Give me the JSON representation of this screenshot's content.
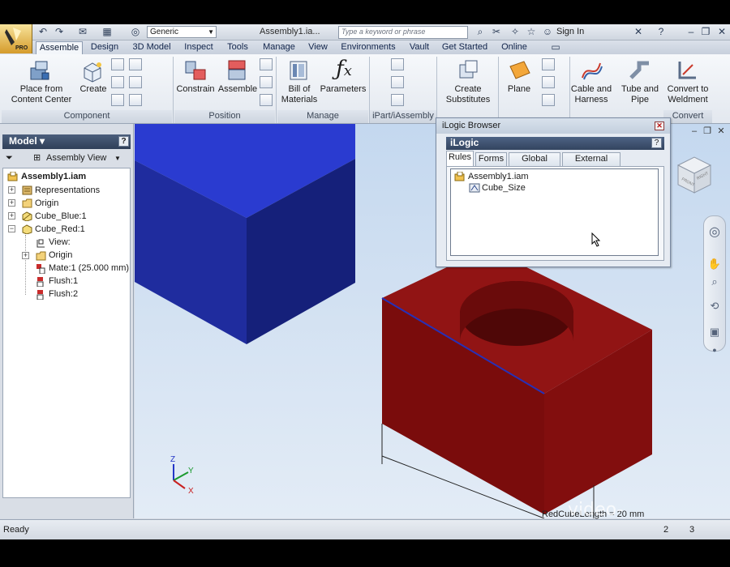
{
  "quick_access": {
    "style_value": "Generic",
    "document_title": "Assembly1.ia...",
    "search_placeholder": "Type a keyword or phrase",
    "sign_in": "Sign In",
    "app_badge": "PRO"
  },
  "tabs": [
    "Assemble",
    "Design",
    "3D Model",
    "Inspect",
    "Tools",
    "Manage",
    "View",
    "Environments",
    "Vault",
    "Get Started",
    "Online"
  ],
  "active_tab": "Assemble",
  "ribbon": {
    "place_line1": "Place from",
    "place_line2": "Content Center",
    "create": "Create",
    "constrain": "Constrain",
    "assemble": "Assemble",
    "bom_line1": "Bill of",
    "bom_line2": "Materials",
    "parameters": "Parameters",
    "substitutes_line1": "Create",
    "substitutes_line2": "Substitutes",
    "plane": "Plane",
    "cable_line1": "Cable and",
    "cable_line2": "Harness",
    "tube_line1": "Tube and",
    "tube_line2": "Pipe",
    "weldment_line1": "Convert to",
    "weldment_line2": "Weldment",
    "groups": {
      "component": "Component",
      "position": "Position",
      "manage": "Manage",
      "ipart": "iPart/iAssembly",
      "convert": "Convert"
    }
  },
  "browser": {
    "title": "Model",
    "view_combo": "Assembly View",
    "nodes": {
      "root": "Assembly1.iam",
      "representations": "Representations",
      "origin": "Origin",
      "cube_blue": "Cube_Blue:1",
      "cube_red": "Cube_Red:1",
      "view": "View:",
      "origin2": "Origin",
      "mate": "Mate:1 (25.000 mm)",
      "flush1": "Flush:1",
      "flush2": "Flush:2"
    }
  },
  "ilogic": {
    "window_title": "iLogic Browser",
    "panel_title": "iLogic",
    "tabs": [
      "Rules",
      "Forms",
      "Global Forms",
      "External Rules"
    ],
    "active_tab": "Rules",
    "tree_root": "Assembly1.iam",
    "rule": "Cube_Size"
  },
  "viewport": {
    "dimension_label": "RedCubeLength = 20 mm",
    "watermark": "video-tutorials.net",
    "axes": [
      "Z",
      "Y",
      "X"
    ],
    "viewcube_labels": [
      "FRONT",
      "RIGHT"
    ]
  },
  "status": {
    "text": "Ready",
    "count1": "2",
    "count2": "3"
  },
  "colors": {
    "blue_cube": "#1c2ca8",
    "red_cube": "#8a0e0e",
    "viewport_bg": "#c8dbef"
  }
}
